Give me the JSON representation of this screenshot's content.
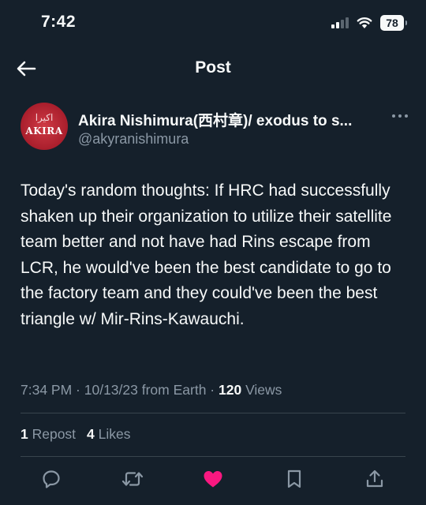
{
  "status_bar": {
    "time": "7:42",
    "battery": "78"
  },
  "header": {
    "title": "Post"
  },
  "author": {
    "avatar_text_arabic": "اكيرا",
    "avatar_text_latin": "AKIRA",
    "display_name": "Akira Nishimura(西村章)/ exodus to s...",
    "handle": "@akyranishimura"
  },
  "tweet": {
    "text": "Today's random thoughts: If HRC had successfully shaken up their organization to utilize their satellite team better and not have had Rins escape from LCR, he would've been the best candidate to go to the factory team and they could've been the best triangle w/ Mir-Rins-Kawauchi."
  },
  "meta": {
    "time": "7:34 PM",
    "sep1": " · ",
    "date": "10/13/23",
    "source": " from Earth",
    "sep2": " · ",
    "views_count": "120",
    "views_label": " Views"
  },
  "stats": {
    "reposts_count": "1",
    "reposts_label": " Repost",
    "likes_count": "4",
    "likes_label": " Likes"
  },
  "colors": {
    "background": "#15202b",
    "text": "#f7f9f9",
    "muted": "#8b98a5",
    "like": "#f91880",
    "divider": "#38444d"
  },
  "icons": [
    "back-arrow-icon",
    "more-icon",
    "reply-icon",
    "repost-icon",
    "like-heart-icon",
    "bookmark-icon",
    "share-icon",
    "signal-icon",
    "wifi-icon",
    "battery-icon"
  ]
}
